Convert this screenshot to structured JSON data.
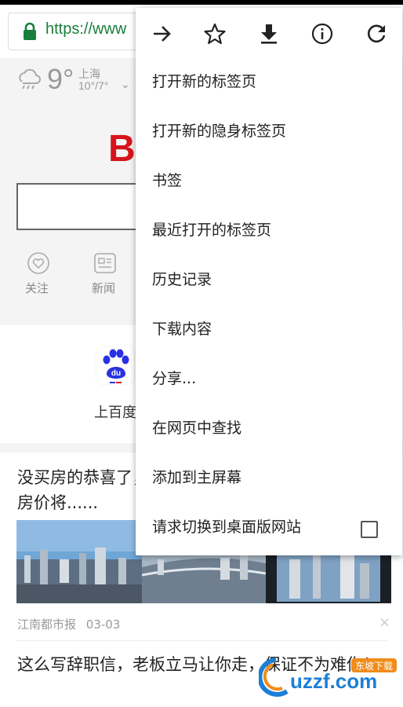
{
  "browser": {
    "url": "https://www"
  },
  "weather": {
    "temperature": "9°",
    "city": "上海",
    "range": "10°/7°",
    "chevron": "⌄"
  },
  "baidu": {
    "logo_fragment": "B"
  },
  "nav_shortcuts": [
    {
      "label": "关注",
      "icon": "heart-icon"
    },
    {
      "label": "新闻",
      "icon": "news-icon"
    }
  ],
  "apps": {
    "label": "上百度"
  },
  "feed": {
    "item1": {
      "headline": "没买房的恭喜了，房价将......",
      "source": "江南都市报",
      "date": "03-03",
      "close": "×"
    },
    "item2": {
      "headline": "这么写辞职信，老板立马让你走，保证不为难你！"
    }
  },
  "menu": {
    "icons": [
      "forward-icon",
      "star-icon",
      "download-icon",
      "info-icon",
      "refresh-icon"
    ],
    "items": [
      {
        "label": "打开新的标签页"
      },
      {
        "label": "打开新的隐身标签页"
      },
      {
        "label": "书签"
      },
      {
        "label": "最近打开的标签页"
      },
      {
        "label": "历史记录"
      },
      {
        "label": "下载内容"
      },
      {
        "label": "分享..."
      },
      {
        "label": "在网页中查找"
      },
      {
        "label": "添加到主屏幕"
      },
      {
        "label": "请求切换到桌面版网站"
      }
    ]
  },
  "watermark": {
    "text": "uzzf.com",
    "tag": "东坡下载"
  },
  "colors": {
    "secure_green": "#1a7e3c",
    "baidu_red": "#d5141b",
    "baidu_blue": "#2932e1"
  }
}
